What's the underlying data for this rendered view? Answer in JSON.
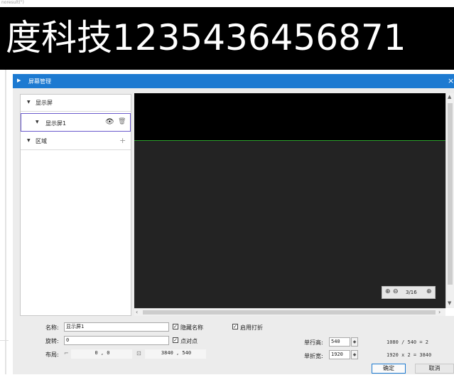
{
  "caption": "noresult(\")",
  "banner": {
    "text": "度科技1235436456871"
  },
  "dialog": {
    "title": "屏幕管理",
    "icon": "monitor-icon",
    "close": "×"
  },
  "tree": {
    "root": {
      "label": "显示屏",
      "icon": "caret-down-icon"
    },
    "screen": {
      "label": "显示屏1",
      "icon": "caret-down-icon",
      "eye": "eye-icon",
      "trash": "trash-icon"
    },
    "region": {
      "label": "区域",
      "icon": "caret-down-icon",
      "add": "plus-icon"
    }
  },
  "canvas": {
    "zoom_in": "zoom-in-icon",
    "zoom_out": "zoom-out-icon",
    "zoom_level": "3/16",
    "fit": "fit-icon"
  },
  "form": {
    "name_label": "名称:",
    "name_value": "显示屏1",
    "hide_name_label": "隐藏名称",
    "hide_name_checked": true,
    "rotate_label": "旋转:",
    "rotate_value": "0",
    "p2p_label": "点对点",
    "p2p_checked": true,
    "layout_label": "布局:",
    "layout_pos": "0 , 0",
    "layout_size": "3840 , 540",
    "fold_label": "启用打折",
    "fold_checked": true,
    "row_height_label": "单行高:",
    "row_height_value": "540",
    "row_height_formula": "1080 / 540 = 2",
    "fold_width_label": "单折宽:",
    "fold_width_value": "1920",
    "fold_width_formula": "1920 x 2 = 3840"
  },
  "buttons": {
    "ok": "确定",
    "cancel": "取消"
  }
}
